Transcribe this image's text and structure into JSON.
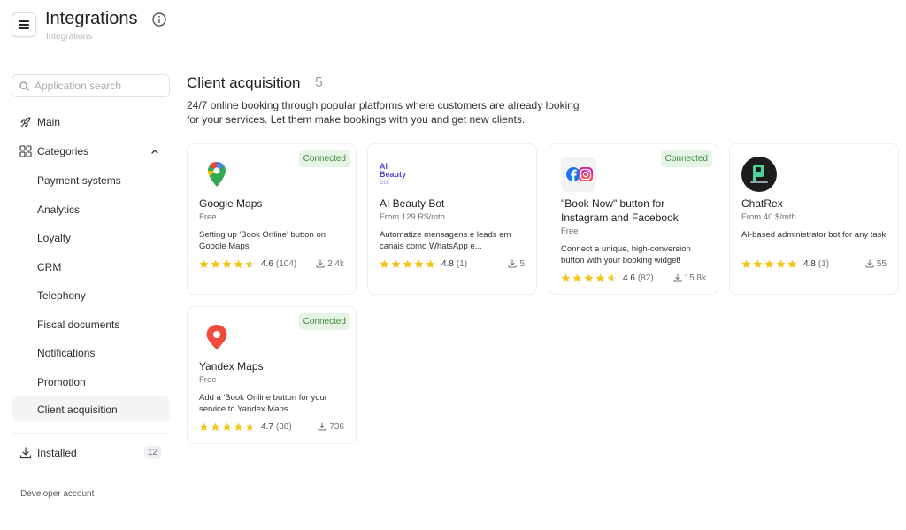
{
  "header": {
    "title": "Integrations",
    "breadcrumb": "Integrations"
  },
  "sidebar": {
    "search_placeholder": "Application search",
    "main_label": "Main",
    "categories_label": "Categories",
    "categories": [
      {
        "label": "Payment systems"
      },
      {
        "label": "Analytics"
      },
      {
        "label": "Loyalty"
      },
      {
        "label": "CRM"
      },
      {
        "label": "Telephony"
      },
      {
        "label": "Fiscal documents"
      },
      {
        "label": "Notifications"
      },
      {
        "label": "Promotion"
      },
      {
        "label": "Client acquisition",
        "active": true
      }
    ],
    "installed_label": "Installed",
    "installed_count": "12",
    "developer_account": "Developer account"
  },
  "main": {
    "section_title": "Client acquisition",
    "section_count": "5",
    "section_desc": "24/7 online booking through popular platforms where customers are already looking for your services. Let them make bookings with you and get new clients.",
    "connected_label": "Connected",
    "cards": [
      {
        "name": "Google Maps",
        "price": "Free",
        "desc": "Setting up 'Book Online' button on Google Maps",
        "rating": "4.6",
        "reviews": "(104)",
        "downloads": "2.4k",
        "connected": true,
        "logo": "google-maps-logo",
        "stars": 4.6
      },
      {
        "name": "AI Beauty Bot",
        "price": "From 129 R$/mth",
        "desc": "Automatize mensagens e leads em canais como WhatsApp e...",
        "rating": "4.8",
        "reviews": "(1)",
        "downloads": "5",
        "connected": false,
        "logo": "ai-beauty-bot-logo",
        "logo_text_1": "AI Beauty",
        "logo_text_2": "bot",
        "stars": 4.8
      },
      {
        "name": "\"Book Now\" button for Instagram and Facebook",
        "price": "Free",
        "desc": "Connect a unique, high-conversion button with your booking widget!",
        "rating": "4.6",
        "reviews": "(82)",
        "downloads": "15.8k",
        "connected": true,
        "logo": "facebook-instagram-logo",
        "stars": 4.6
      },
      {
        "name": "ChatRex",
        "price": "From 40 $/mth",
        "desc": "AI-based administrator bot for any task",
        "rating": "4.8",
        "reviews": "(1)",
        "downloads": "55",
        "connected": false,
        "logo": "chatrex-logo",
        "stars": 4.8
      },
      {
        "name": "Yandex Maps",
        "price": "Free",
        "desc": "Add a 'Book Online button for your service to Yandex Maps",
        "rating": "4.7",
        "reviews": "(38)",
        "downloads": "736",
        "connected": true,
        "logo": "yandex-maps-logo",
        "stars": 4.7
      }
    ]
  },
  "colors": {
    "star": "#f5c518",
    "connected_bg": "#e6f4e5",
    "connected_text": "#3b8a3a"
  }
}
